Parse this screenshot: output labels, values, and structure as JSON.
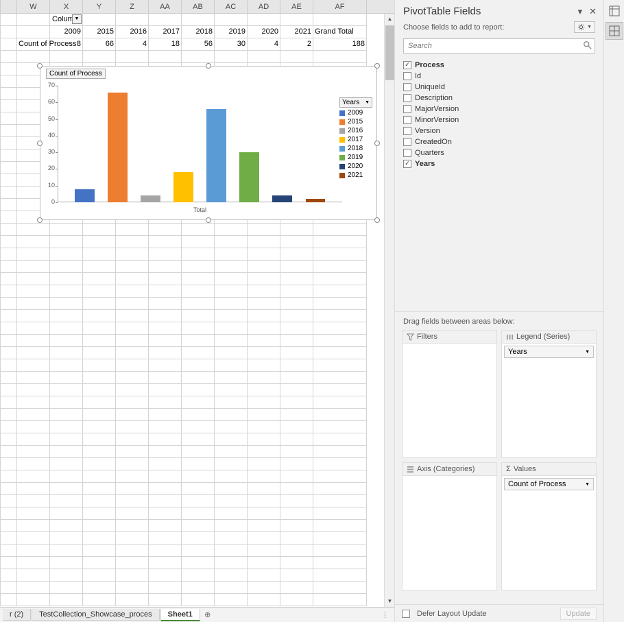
{
  "columns": [
    "W",
    "X",
    "Y",
    "Z",
    "AA",
    "AB",
    "AC",
    "AD",
    "AE",
    "AF"
  ],
  "pivot": {
    "column_dd_label": "Column",
    "row_label": "Count of Process",
    "years": [
      "2009",
      "2015",
      "2016",
      "2017",
      "2018",
      "2019",
      "2020",
      "2021"
    ],
    "grand_total_label": "Grand Total",
    "values": [
      8,
      66,
      4,
      18,
      56,
      30,
      4,
      2
    ],
    "grand_total": 188
  },
  "chart_data": {
    "type": "bar",
    "title": "Count of Process",
    "legend_title": "Years",
    "categories": [
      "2009",
      "2015",
      "2016",
      "2017",
      "2018",
      "2019",
      "2020",
      "2021"
    ],
    "values": [
      8,
      66,
      4,
      18,
      56,
      30,
      4,
      2
    ],
    "colors": [
      "#4472c4",
      "#ed7d31",
      "#a5a5a5",
      "#ffc000",
      "#5b9bd5",
      "#70ad47",
      "#264478",
      "#9e480e"
    ],
    "xlabel": "Total",
    "ylim": [
      0,
      70
    ],
    "yticks": [
      0,
      10,
      20,
      30,
      40,
      50,
      60,
      70
    ]
  },
  "sheet_tabs": {
    "prev": "r (2)",
    "tab1": "TestCollection_Showcase_proces",
    "tab2": "Sheet1"
  },
  "pivot_pane": {
    "title": "PivotTable Fields",
    "subtitle": "Choose fields to add to report:",
    "search_placeholder": "Search",
    "fields": [
      {
        "name": "Process",
        "checked": true
      },
      {
        "name": "Id",
        "checked": false
      },
      {
        "name": "UniqueId",
        "checked": false
      },
      {
        "name": "Description",
        "checked": false
      },
      {
        "name": "MajorVersion",
        "checked": false
      },
      {
        "name": "MinorVersion",
        "checked": false
      },
      {
        "name": "Version",
        "checked": false
      },
      {
        "name": "CreatedOn",
        "checked": false
      },
      {
        "name": "Quarters",
        "checked": false
      },
      {
        "name": "Years",
        "checked": true
      }
    ],
    "areas_header": "Drag fields between areas below:",
    "area_filters": "Filters",
    "area_legend": "Legend (Series)",
    "area_axis": "Axis (Categories)",
    "area_values": "Values",
    "legend_item": "Years",
    "values_item": "Count of Process",
    "defer_label": "Defer Layout Update",
    "update_label": "Update"
  }
}
